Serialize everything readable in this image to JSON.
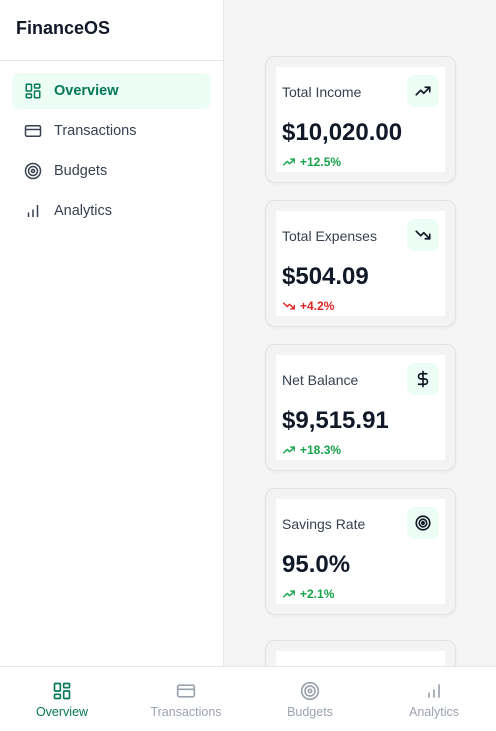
{
  "app": {
    "title": "FinanceOS"
  },
  "sidebar": {
    "items": [
      {
        "label": "Overview",
        "icon": "grid-icon",
        "active": true
      },
      {
        "label": "Transactions",
        "icon": "credit-card-icon",
        "active": false
      },
      {
        "label": "Budgets",
        "icon": "target-icon",
        "active": false
      },
      {
        "label": "Analytics",
        "icon": "bar-chart-icon",
        "active": false
      }
    ]
  },
  "cards": [
    {
      "title": "Total Income",
      "value": "$10,020.00",
      "change": "+12.5%",
      "trend": "up",
      "icon": "trending-up-icon"
    },
    {
      "title": "Total Expenses",
      "value": "$504.09",
      "change": "+4.2%",
      "trend": "down",
      "icon": "trending-down-icon"
    },
    {
      "title": "Net Balance",
      "value": "$9,515.91",
      "change": "+18.3%",
      "trend": "up",
      "icon": "dollar-icon"
    },
    {
      "title": "Savings Rate",
      "value": "95.0%",
      "change": "+2.1%",
      "trend": "up",
      "icon": "target-icon"
    }
  ],
  "bottom_nav": {
    "items": [
      {
        "label": "Overview",
        "active": true
      },
      {
        "label": "Transactions",
        "active": false
      },
      {
        "label": "Budgets",
        "active": false
      },
      {
        "label": "Analytics",
        "active": false
      }
    ]
  },
  "colors": {
    "accent": "#047857",
    "accent_bg": "#ecfdf5",
    "up": "#16a34a",
    "down": "#dc2626"
  }
}
